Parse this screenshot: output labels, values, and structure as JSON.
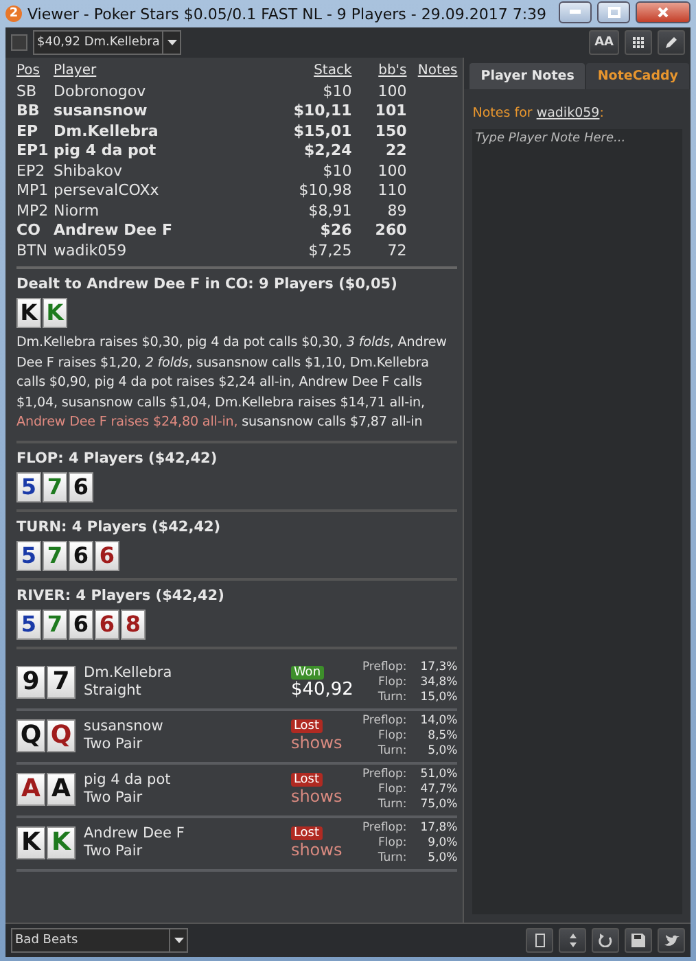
{
  "window": {
    "badge": "2",
    "title": "Viewer - Poker Stars $0.05/0.1 FAST NL - 9 Players - 29.09.2017 7:39"
  },
  "toolbar": {
    "checked": false,
    "hand_select": "$40,92 Dm.Kellebra",
    "font_button": "AA"
  },
  "players": {
    "columns": [
      "Pos",
      "Player",
      "Stack",
      "bb's",
      "Notes"
    ],
    "rows": [
      {
        "pos": "SB",
        "name": "Dobronogov",
        "stack": "$10",
        "bbs": "100",
        "in_hand": false
      },
      {
        "pos": "BB",
        "name": "susansnow",
        "stack": "$10,11",
        "bbs": "101",
        "in_hand": true
      },
      {
        "pos": "EP",
        "name": "Dm.Kellebra",
        "stack": "$15,01",
        "bbs": "150",
        "in_hand": true
      },
      {
        "pos": "EP1",
        "name": "pig 4 da pot",
        "stack": "$2,24",
        "bbs": "22",
        "in_hand": true
      },
      {
        "pos": "EP2",
        "name": "Shibakov",
        "stack": "$10",
        "bbs": "100",
        "in_hand": false
      },
      {
        "pos": "MP1",
        "name": "persevalCOXx",
        "stack": "$10,98",
        "bbs": "110",
        "in_hand": false
      },
      {
        "pos": "MP2",
        "name": "Niorm",
        "stack": "$8,91",
        "bbs": "89",
        "in_hand": false
      },
      {
        "pos": "CO",
        "name": "Andrew Dee F",
        "stack": "$26",
        "bbs": "260",
        "in_hand": true
      },
      {
        "pos": "BTN",
        "name": "wadik059",
        "stack": "$7,25",
        "bbs": "72",
        "in_hand": false
      }
    ]
  },
  "streets": [
    {
      "title": "Dealt to Andrew Dee F in CO: 9 Players ($0,05)",
      "cards": [
        {
          "rank": "K",
          "color": "#111111"
        },
        {
          "rank": "K",
          "color": "#1e7a1e"
        }
      ],
      "actions": [
        {
          "kind": "plain",
          "text": "Dm.Kellebra raises $0,30, pig 4 da pot calls $0,30, "
        },
        {
          "kind": "italic",
          "text": "3 folds"
        },
        {
          "kind": "plain",
          "text": ", Andrew Dee F raises $1,20, "
        },
        {
          "kind": "italic",
          "text": "2 folds"
        },
        {
          "kind": "plain",
          "text": ", susansnow calls $1,10, Dm.Kellebra calls $0,90, pig 4 da pot raises $2,24 all-in, Andrew Dee F calls $1,04, susansnow calls $1,04, Dm.Kellebra raises $14,71 all-in, "
        },
        {
          "kind": "hero",
          "text": "Andrew Dee F raises $24,80 all-in,"
        },
        {
          "kind": "plain",
          "text": " susansnow calls $7,87 all-in"
        }
      ]
    },
    {
      "title": "FLOP: 4 Players ($42,42)",
      "cards": [
        {
          "rank": "5",
          "color": "#1a3aa8"
        },
        {
          "rank": "7",
          "color": "#1e7a1e"
        },
        {
          "rank": "6",
          "color": "#111111"
        }
      ]
    },
    {
      "title": "TURN: 4 Players ($42,42)",
      "cards": [
        {
          "rank": "5",
          "color": "#1a3aa8"
        },
        {
          "rank": "7",
          "color": "#1e7a1e"
        },
        {
          "rank": "6",
          "color": "#111111"
        },
        {
          "rank": "6",
          "color": "#a01c1c"
        }
      ]
    },
    {
      "title": "RIVER: 4 Players ($42,42)",
      "cards": [
        {
          "rank": "5",
          "color": "#1a3aa8"
        },
        {
          "rank": "7",
          "color": "#1e7a1e"
        },
        {
          "rank": "6",
          "color": "#111111"
        },
        {
          "rank": "6",
          "color": "#a01c1c"
        },
        {
          "rank": "8",
          "color": "#a01c1c"
        }
      ]
    }
  ],
  "results": [
    {
      "cards": [
        {
          "rank": "9",
          "color": "#111111"
        },
        {
          "rank": "7",
          "color": "#111111"
        }
      ],
      "name": "Dm.Kellebra",
      "hand": "Straight",
      "outcome": {
        "kind": "won",
        "label": "Won"
      },
      "amount": "$40,92",
      "equity": [
        {
          "label": "Preflop:",
          "value": "17,3%"
        },
        {
          "label": "Flop:",
          "value": "34,8%"
        },
        {
          "label": "Turn:",
          "value": "15,0%"
        }
      ]
    },
    {
      "cards": [
        {
          "rank": "Q",
          "color": "#111111"
        },
        {
          "rank": "Q",
          "color": "#a01c1c"
        }
      ],
      "name": "susansnow",
      "hand": "Two Pair",
      "outcome": {
        "kind": "lost",
        "label": "Lost"
      },
      "amount": "shows",
      "equity": [
        {
          "label": "Preflop:",
          "value": "14,0%"
        },
        {
          "label": "Flop:",
          "value": "8,5%"
        },
        {
          "label": "Turn:",
          "value": "5,0%"
        }
      ]
    },
    {
      "cards": [
        {
          "rank": "A",
          "color": "#a01c1c"
        },
        {
          "rank": "A",
          "color": "#111111"
        }
      ],
      "name": "pig 4 da pot",
      "hand": "Two Pair",
      "outcome": {
        "kind": "lost",
        "label": "Lost"
      },
      "amount": "shows",
      "equity": [
        {
          "label": "Preflop:",
          "value": "51,0%"
        },
        {
          "label": "Flop:",
          "value": "47,7%"
        },
        {
          "label": "Turn:",
          "value": "75,0%"
        }
      ]
    },
    {
      "cards": [
        {
          "rank": "K",
          "color": "#111111"
        },
        {
          "rank": "K",
          "color": "#1e7a1e"
        }
      ],
      "name": "Andrew Dee F",
      "hand": "Two Pair",
      "outcome": {
        "kind": "lost",
        "label": "Lost"
      },
      "amount": "shows",
      "equity": [
        {
          "label": "Preflop:",
          "value": "17,8%"
        },
        {
          "label": "Flop:",
          "value": "9,0%"
        },
        {
          "label": "Turn:",
          "value": "5,0%"
        }
      ]
    }
  ],
  "notes_panel": {
    "tabs": [
      {
        "label": "Player Notes",
        "selected": true
      },
      {
        "label": "NoteCaddy",
        "selected": false
      }
    ],
    "notes_for": "Notes for ",
    "player": "wadik059",
    "colon": ":",
    "placeholder": "Type Player Note Here..."
  },
  "bottom_bar": {
    "filter": "Bad Beats"
  }
}
